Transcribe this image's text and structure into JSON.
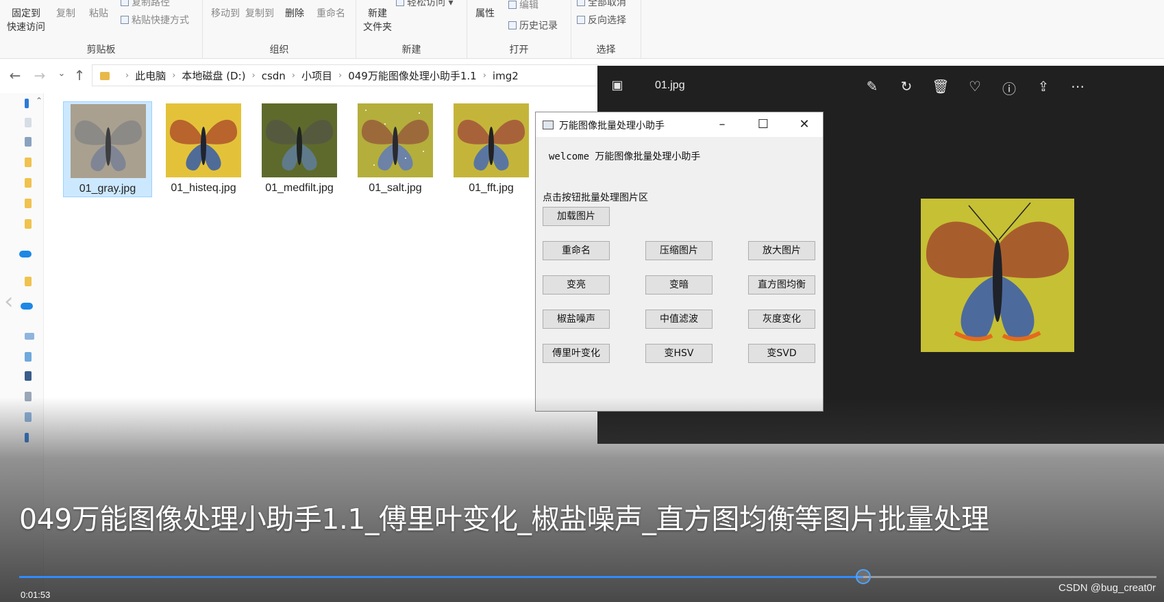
{
  "ribbon": {
    "clipboard": {
      "pin_label": "固定到\n快速访问",
      "copy_label": "复制",
      "paste_label": "粘贴",
      "copy_path_label": "复制路径",
      "paste_shortcut_label": "粘贴快捷方式",
      "group_label": "剪贴板"
    },
    "organize": {
      "move_to_label": "移动到",
      "copy_to_label": "复制到",
      "delete_label": "删除",
      "rename_label": "重命名",
      "group_label": "组织"
    },
    "new": {
      "new_folder_label": "新建\n文件夹",
      "easy_access_label": "轻松访问",
      "group_label": "新建"
    },
    "open": {
      "properties_label": "属性",
      "edit_label": "编辑",
      "history_label": "历史记录",
      "group_label": "打开"
    },
    "select": {
      "select_none_label": "全部取消",
      "invert_label": "反向选择",
      "group_label": "选择"
    }
  },
  "breadcrumb": [
    "此电脑",
    "本地磁盘 (D:)",
    "csdn",
    "小项目",
    "049万能图像处理小助手1.1",
    "img2"
  ],
  "files": [
    {
      "name": "01_gray.jpg",
      "selected": true
    },
    {
      "name": "01_histeq.jpg",
      "selected": false
    },
    {
      "name": "01_medfilt.jpg",
      "selected": false
    },
    {
      "name": "01_salt.jpg",
      "selected": false
    },
    {
      "name": "01_fft.jpg",
      "selected": false
    }
  ],
  "viewer": {
    "filename": "01.jpg"
  },
  "tool": {
    "title": "万能图像批量处理小助手",
    "welcome": "welcome 万能图像批量处理小助手",
    "section_label": "点击按钮批量处理图片区",
    "load_button": "加载图片",
    "buttons": [
      "重命名",
      "压缩图片",
      "放大图片",
      "变亮",
      "变暗",
      "直方图均衡",
      "椒盐噪声",
      "中值滤波",
      "灰度变化",
      "傅里叶变化",
      "变HSV",
      "变SVD"
    ]
  },
  "video": {
    "title": "049万能图像处理小助手1.1_傅里叶变化_椒盐噪声_直方图均衡等图片批量处理",
    "time": "0:01:53",
    "progress": 0.742,
    "watermark": "CSDN @bug_creat0r",
    "accent_color": "#2f8cff"
  }
}
